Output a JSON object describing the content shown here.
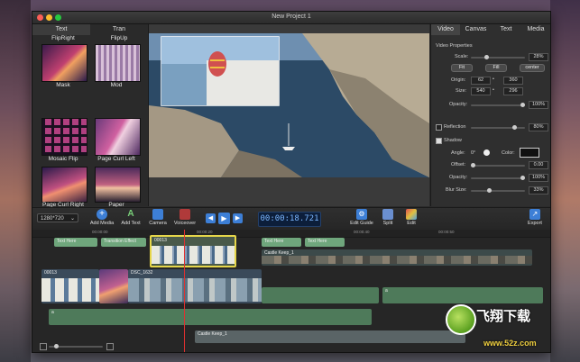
{
  "window": {
    "title": "New Project 1"
  },
  "left_panel": {
    "tabs": [
      "Text",
      "Tran"
    ],
    "transitions": [
      "FlipRight",
      "FlipUp",
      "Mask",
      "Mod",
      "Mosaic Flip",
      "Page Curl Left",
      "Page Curl Right",
      "Paper"
    ]
  },
  "right_panel": {
    "tabs": [
      "Video",
      "Canvas",
      "Text",
      "Media"
    ],
    "video_properties": {
      "heading": "Video Properties",
      "scale_label": "Scale:",
      "scale_value": "28%",
      "fit_buttons": [
        "Fit",
        "Fill",
        "center"
      ],
      "origin_label": "Origin:",
      "origin_x": "62",
      "origin_y": "360",
      "size_label": "Size:",
      "size_w": "540",
      "size_h": "296",
      "opacity_label": "Opacity:",
      "opacity_value": "100%",
      "reflection_label": "Reflection",
      "reflection_value": "80%",
      "shadow_label": "Shadow",
      "angle_label": "Angle:",
      "angle_value": "0°",
      "color_label": "Color:",
      "offset_label": "Offset:",
      "offset_value": "0.00",
      "shadow_opacity_label": "Opacity:",
      "shadow_opacity_value": "100%",
      "blur_label": "Blur Size:",
      "blur_value": "33%"
    },
    "slider_levels": {
      "scale": 0.28,
      "opacity": 1.0,
      "reflection": 0.8,
      "offset": 0.0,
      "shadow_opacity": 1.0,
      "blur": 0.33
    }
  },
  "toolbar": {
    "resolution": "1280*720",
    "add_media": "Add Media",
    "add_text": "Add Text",
    "camera": "Camera",
    "voiceover": "Voiceover",
    "timecode": "00:00:18.721",
    "edit_guide": "Edit Guide",
    "split": "Split",
    "edit": "Edit",
    "export": "Export"
  },
  "timeline": {
    "ruler": [
      "00:00:00",
      "00:00:20",
      "00:00:40",
      "00:00:50"
    ],
    "clips": {
      "text1": "Text Here",
      "trans": "Transition Effect",
      "clip13a": "00013",
      "text2": "Text Here",
      "text3": "Text Here",
      "castle1": "Castle Keep_1",
      "clip13b": "00013",
      "dsc": "DSC_1632",
      "audio1": "a",
      "audio2": "a",
      "castle2": "Castle Keep_1"
    }
  },
  "watermark": {
    "brand": "飞翔下载",
    "url": "www.52z.com"
  },
  "colors": {
    "accent_blue": "#3d7fd6",
    "clip_green": "#6fa67c",
    "clip_selected": "#e6d64a",
    "playhead": "#e03030",
    "timecode_bg": "#0c1e3a"
  }
}
